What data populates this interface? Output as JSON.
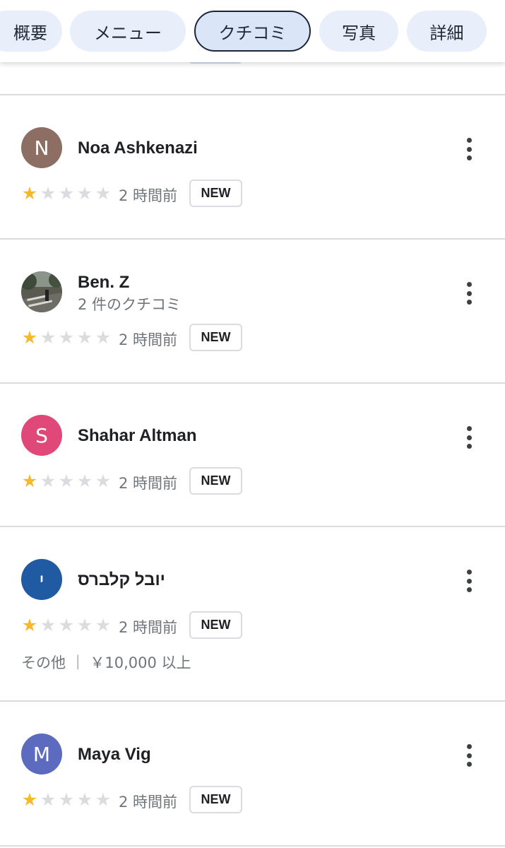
{
  "tabs": [
    {
      "label": "概要",
      "active": false
    },
    {
      "label": "メニュー",
      "active": false
    },
    {
      "label": "クチコミ",
      "active": true
    },
    {
      "label": "写真",
      "active": false
    },
    {
      "label": "詳細",
      "active": false
    }
  ],
  "reviews": [
    {
      "initial": "N",
      "name": "Noa Ashkenazi",
      "subtext": "",
      "avatar_color": "#8d6e63",
      "rating": 1,
      "time": "2 時間前",
      "badge": "NEW",
      "meta": ""
    },
    {
      "initial": "",
      "name": "Ben. Z",
      "subtext": "2 件のクチコミ",
      "avatar_color": "#4a4a44",
      "avatar_icon": "photo-avatar",
      "rating": 1,
      "time": "2 時間前",
      "badge": "NEW",
      "meta": ""
    },
    {
      "initial": "S",
      "name": "Shahar Altman",
      "subtext": "",
      "avatar_color": "#e0487a",
      "rating": 1,
      "time": "2 時間前",
      "badge": "NEW",
      "meta": ""
    },
    {
      "initial": "י",
      "name": "יובל קלברס",
      "subtext": "",
      "avatar_color": "#1f5aa3",
      "rating": 1,
      "time": "2 時間前",
      "badge": "NEW",
      "meta": "その他 ｜ ￥10,000 以上"
    },
    {
      "initial": "M",
      "name": "Maya Vig",
      "subtext": "",
      "avatar_color": "#5c6bc0",
      "rating": 1,
      "time": "2 時間前",
      "badge": "NEW",
      "meta": ""
    }
  ],
  "icons": {
    "star": "star-icon",
    "more": "more-vert-icon"
  },
  "colors": {
    "star_filled": "#f5b92c",
    "star_empty": "#dadce0",
    "chip_bg": "#e8eefa"
  }
}
